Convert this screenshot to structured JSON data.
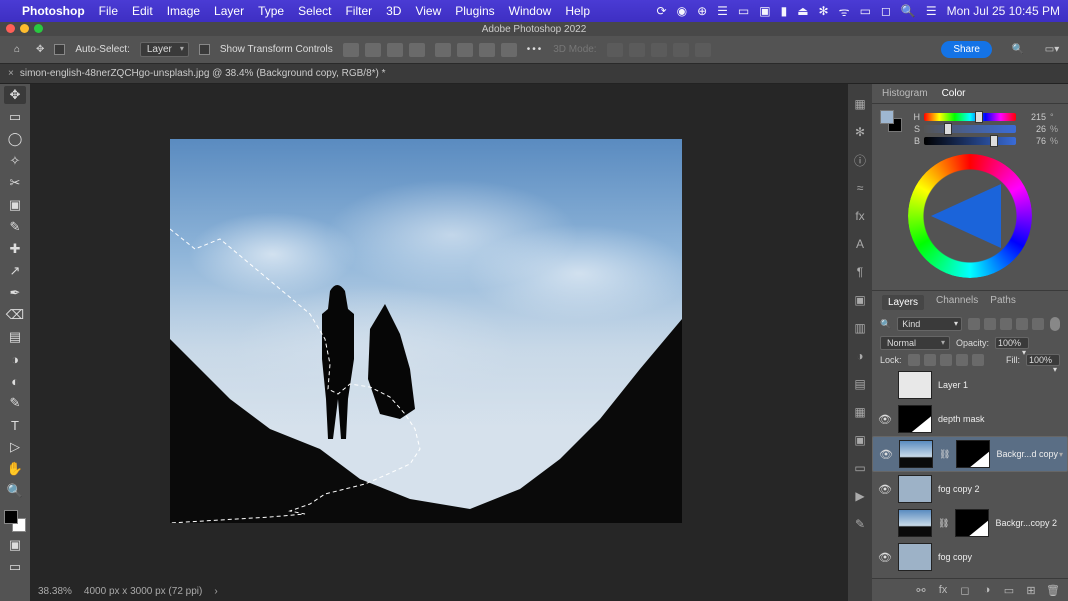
{
  "menubar": {
    "apple": "",
    "app": "Photoshop",
    "items": [
      "File",
      "Edit",
      "Image",
      "Layer",
      "Type",
      "Select",
      "Filter",
      "3D",
      "View",
      "Plugins",
      "Window",
      "Help"
    ],
    "clock": "Mon Jul 25  10:45 PM"
  },
  "titlebar": {
    "title": "Adobe Photoshop 2022"
  },
  "optbar": {
    "auto_select": "Auto-Select:",
    "auto_select_mode": "Layer",
    "show_transform": "Show Transform Controls",
    "mode3d": "3D Mode:",
    "share": "Share"
  },
  "tab": {
    "filename": "simon-english-48nerZQCHgo-unsplash.jpg @ 38.4% (Background copy, RGB/8*) *"
  },
  "status": {
    "zoom": "38.38%",
    "docinfo": "4000 px x 3000 px (72 ppi)"
  },
  "color_tabs": {
    "a": "Histogram",
    "b": "Color"
  },
  "hsb": {
    "h": {
      "label": "H",
      "val": "215",
      "pos": 60
    },
    "s": {
      "label": "S",
      "val": "26",
      "pct": "%",
      "pos": 26
    },
    "b": {
      "label": "B",
      "val": "76",
      "pct": "%",
      "pos": 76
    }
  },
  "layer_tabs": {
    "a": "Layers",
    "b": "Channels",
    "c": "Paths"
  },
  "layers": {
    "kind_prefix": "Kind",
    "blend": "Normal",
    "opacity_label": "Opacity:",
    "opacity_val": "100%",
    "fill_label": "Fill:",
    "fill_val": "100%",
    "lock_label": "Lock:",
    "items": [
      {
        "vis": false,
        "name": "Layer 1",
        "style": "white",
        "mask": null,
        "sel": false
      },
      {
        "vis": true,
        "name": "depth mask",
        "style": "mask",
        "mask": null,
        "sel": false
      },
      {
        "vis": true,
        "name": "Backgr...d copy",
        "style": "sky",
        "mask": "mask",
        "sel": true
      },
      {
        "vis": true,
        "name": "fog copy 2",
        "style": "fog",
        "mask": null,
        "sel": false
      },
      {
        "vis": false,
        "name": "Backgr...copy 2",
        "style": "sky",
        "mask": "mask",
        "sel": false
      },
      {
        "vis": true,
        "name": "fog copy",
        "style": "fog",
        "mask": null,
        "sel": false
      }
    ]
  },
  "tools": [
    "✥",
    "▭",
    "◯",
    "✧",
    "✂",
    "▣",
    "✎",
    "✚",
    "↗",
    "✒",
    "⌫",
    "▤",
    "◑",
    "◐",
    "✎",
    "T",
    "▷",
    "✋",
    "🔍"
  ]
}
